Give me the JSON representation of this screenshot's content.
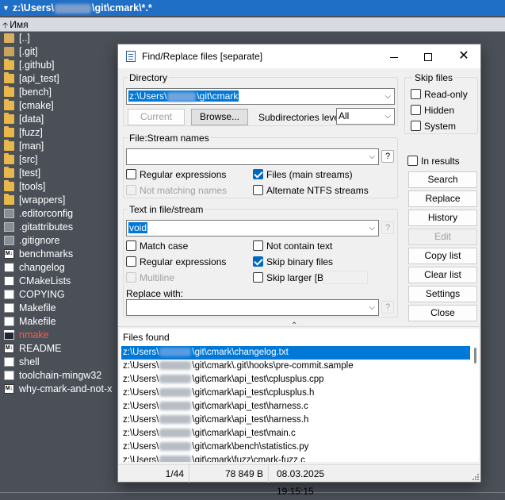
{
  "panel": {
    "path_prefix": "z:\\Users\\",
    "path_suffix": "\\git\\cmark\\*.*",
    "column_name": "Имя",
    "files": [
      {
        "name": "[..]",
        "icon": "parent-folder-icon",
        "kind": "parent"
      },
      {
        "name": "[.git]",
        "icon": "gear-folder-icon",
        "kind": "gear"
      },
      {
        "name": "[.github]",
        "icon": "folder-icon",
        "kind": "folder"
      },
      {
        "name": "[api_test]",
        "icon": "folder-icon",
        "kind": "folder"
      },
      {
        "name": "[bench]",
        "icon": "folder-icon",
        "kind": "folder"
      },
      {
        "name": "[cmake]",
        "icon": "folder-icon",
        "kind": "folder"
      },
      {
        "name": "[data]",
        "icon": "folder-icon",
        "kind": "folder"
      },
      {
        "name": "[fuzz]",
        "icon": "folder-icon",
        "kind": "folder"
      },
      {
        "name": "[man]",
        "icon": "folder-icon",
        "kind": "folder"
      },
      {
        "name": "[src]",
        "icon": "folder-icon",
        "kind": "folder"
      },
      {
        "name": "[test]",
        "icon": "folder-icon",
        "kind": "folder"
      },
      {
        "name": "[tools]",
        "icon": "folder-icon",
        "kind": "folder"
      },
      {
        "name": "[wrappers]",
        "icon": "folder-icon",
        "kind": "folder"
      },
      {
        "name": ".editorconfig",
        "icon": "git-file-icon",
        "kind": "git"
      },
      {
        "name": ".gitattributes",
        "icon": "git-file-icon",
        "kind": "git"
      },
      {
        "name": ".gitignore",
        "icon": "git-file-icon",
        "kind": "git"
      },
      {
        "name": "benchmarks",
        "icon": "markdown-file-icon",
        "kind": "md"
      },
      {
        "name": "changelog",
        "icon": "text-file-icon",
        "kind": "doc"
      },
      {
        "name": "CMakeLists",
        "icon": "text-file-icon",
        "kind": "doc"
      },
      {
        "name": "COPYING",
        "icon": "blank-file-icon",
        "kind": "blank"
      },
      {
        "name": "Makefile",
        "icon": "blank-file-icon",
        "kind": "blank"
      },
      {
        "name": "Makefile",
        "icon": "blank-file-icon",
        "kind": "blank"
      },
      {
        "name": "nmake",
        "icon": "executable-file-icon",
        "kind": "exe",
        "highlight": true
      },
      {
        "name": "README",
        "icon": "markdown-file-icon",
        "kind": "md"
      },
      {
        "name": "shell",
        "icon": "blank-file-icon",
        "kind": "blank"
      },
      {
        "name": "toolchain-mingw32",
        "icon": "blank-file-icon",
        "kind": "blank"
      },
      {
        "name": "why-cmark-and-not-x",
        "icon": "markdown-file-icon",
        "kind": "md"
      }
    ],
    "colors": {
      "background": "#4b5058",
      "path_bar": "#1f6fc7",
      "highlight_text": "#ff5a4a"
    }
  },
  "dialog": {
    "title": "Find/Replace files [separate]",
    "directory": {
      "group_label": "Directory",
      "path_prefix": "z:\\Users\\",
      "path_suffix": "\\git\\cmark",
      "current_button": "Current",
      "browse_button": "Browse...",
      "subdir_label": "Subdirectories level:",
      "subdir_value": "All"
    },
    "skip_files": {
      "group_label": "Skip files",
      "read_only": "Read-only",
      "hidden": "Hidden",
      "system": "System"
    },
    "file_stream": {
      "group_label": "File:Stream names",
      "value": "",
      "help": "?",
      "regex": "Regular expressions",
      "not_matching": "Not matching names",
      "main_streams": "Files (main streams)",
      "alt_ntfs": "Alternate NTFS streams"
    },
    "text_in_file": {
      "group_label": "Text in file/stream",
      "value": "void",
      "help": "?",
      "match_case": "Match case",
      "not_contain": "Not contain text",
      "regex": "Regular expressions",
      "skip_binary": "Skip binary files",
      "multiline": "Multiline",
      "skip_larger": "Skip larger [B]:",
      "replace_with_label": "Replace with:",
      "replace_value": ""
    },
    "in_results": "In results",
    "buttons": {
      "search": "Search",
      "replace": "Replace",
      "history": "History",
      "edit": "Edit",
      "copy_list": "Copy list",
      "clear_list": "Clear list",
      "settings": "Settings",
      "close": "Close"
    },
    "files_found": {
      "title": "Files found",
      "rows": [
        {
          "prefix": "z:\\Users\\",
          "suffix": "\\git\\cmark\\changelog.txt"
        },
        {
          "prefix": "z:\\Users\\",
          "suffix": "\\git\\cmark\\.git\\hooks\\pre-commit.sample"
        },
        {
          "prefix": "z:\\Users\\",
          "suffix": "\\git\\cmark\\api_test\\cplusplus.cpp"
        },
        {
          "prefix": "z:\\Users\\",
          "suffix": "\\git\\cmark\\api_test\\cplusplus.h"
        },
        {
          "prefix": "z:\\Users\\",
          "suffix": "\\git\\cmark\\api_test\\harness.c"
        },
        {
          "prefix": "z:\\Users\\",
          "suffix": "\\git\\cmark\\api_test\\harness.h"
        },
        {
          "prefix": "z:\\Users\\",
          "suffix": "\\git\\cmark\\api_test\\main.c"
        },
        {
          "prefix": "z:\\Users\\",
          "suffix": "\\git\\cmark\\bench\\statistics.py"
        },
        {
          "prefix": "z:\\Users\\",
          "suffix": "\\git\\cmark\\fuzz\\cmark-fuzz.c"
        }
      ]
    },
    "status": {
      "count": "1/44",
      "size": "78 849 B",
      "datetime": "08.03.2025  19:15:15"
    }
  }
}
